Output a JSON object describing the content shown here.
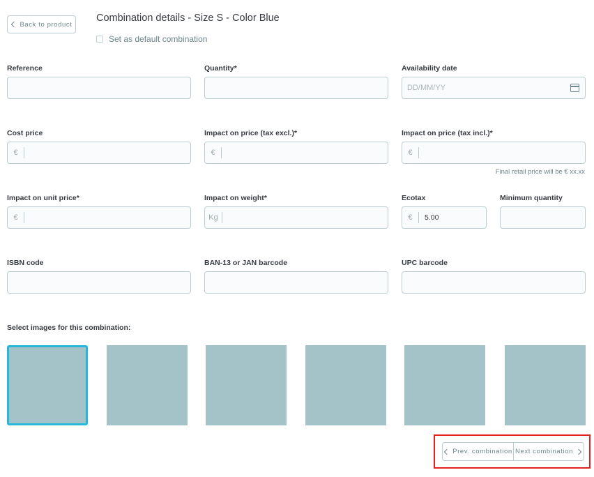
{
  "header": {
    "back_label": "Back to product",
    "title": "Combination details - Size S - Color Blue",
    "default_label": "Set as default combination"
  },
  "fields": {
    "reference": {
      "label": "Reference",
      "value": ""
    },
    "quantity": {
      "label": "Quantity*",
      "value": ""
    },
    "availability": {
      "label": "Availability date",
      "placeholder": "DD/MM/YY"
    },
    "cost_price": {
      "label": "Cost price",
      "addon": "€",
      "value": ""
    },
    "impact_tax_excl": {
      "label": "Impact on price (tax excl.)*",
      "addon": "€",
      "value": ""
    },
    "impact_tax_incl": {
      "label": "Impact on price (tax incl.)*",
      "addon": "€",
      "value": "",
      "hint": "Final retail price will be € xx.xx"
    },
    "impact_unit": {
      "label": "Impact on unit price*",
      "addon": "€",
      "value": ""
    },
    "impact_weight": {
      "label": "Impact on weight*",
      "addon": "Kg",
      "value": ""
    },
    "ecotax": {
      "label": "Ecotax",
      "addon": "€",
      "value": "5.00"
    },
    "min_qty": {
      "label": "Minimum quantity",
      "value": ""
    },
    "isbn": {
      "label": "ISBN code",
      "value": ""
    },
    "ean": {
      "label": "BAN-13 or JAN barcode",
      "value": ""
    },
    "upc": {
      "label": "UPC barcode",
      "value": ""
    }
  },
  "images": {
    "label": "Select images for this combination:",
    "count": 6,
    "selected_index": 0,
    "thumb_color": "#a4c3c8",
    "selected_border": "#25b9d7"
  },
  "navigation": {
    "prev_label": "Prev. combination",
    "next_label": "Next combination",
    "highlight_color": "#e4231f"
  }
}
